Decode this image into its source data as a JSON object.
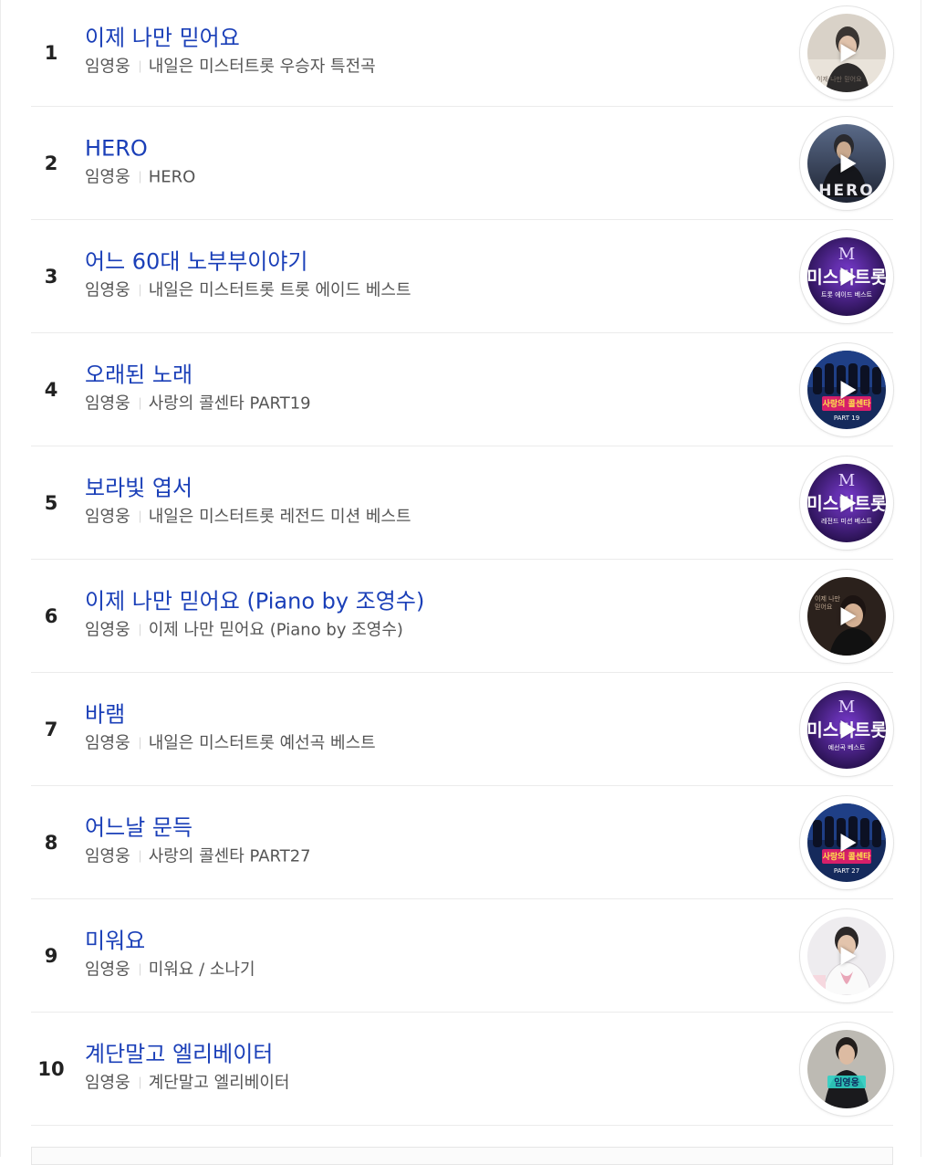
{
  "songs": [
    {
      "rank": "1",
      "title": "이제 나만 믿어요",
      "artist": "임영웅",
      "album": "내일은 미스터트롯 우승자 특전곡",
      "art_icon": "album-art-portrait-light"
    },
    {
      "rank": "2",
      "title": "HERO",
      "artist": "임영웅",
      "album": "HERO",
      "art_icon": "album-art-hero"
    },
    {
      "rank": "3",
      "title": "어느 60대 노부부이야기",
      "artist": "임영웅",
      "album": "내일은 미스터트롯 트롯 에이드 베스트",
      "art_icon": "album-art-mrtrot",
      "art_caption": "트롯 에이드 베스트"
    },
    {
      "rank": "4",
      "title": "오래된 노래",
      "artist": "임영웅",
      "album": "사랑의 콜센타 PART19",
      "art_icon": "album-art-callcenter",
      "art_caption": "PART 19"
    },
    {
      "rank": "5",
      "title": "보라빛 엽서",
      "artist": "임영웅",
      "album": "내일은 미스터트롯 레전드 미션 베스트",
      "art_icon": "album-art-mrtrot",
      "art_caption": "레전드 미션 베스트"
    },
    {
      "rank": "6",
      "title": "이제 나만 믿어요 (Piano by 조영수)",
      "artist": "임영웅",
      "album": "이제 나만 믿어요 (Piano by 조영수)",
      "art_icon": "album-art-portrait-dark"
    },
    {
      "rank": "7",
      "title": "바램",
      "artist": "임영웅",
      "album": "내일은 미스터트롯 예선곡 베스트",
      "art_icon": "album-art-mrtrot",
      "art_caption": "예선곡 베스트"
    },
    {
      "rank": "8",
      "title": "어느날 문득",
      "artist": "임영웅",
      "album": "사랑의 콜센타 PART27",
      "art_icon": "album-art-callcenter",
      "art_caption": "PART 27"
    },
    {
      "rank": "9",
      "title": "미워요",
      "artist": "임영웅",
      "album": "미워요 / 소나기",
      "art_icon": "album-art-portrait-white"
    },
    {
      "rank": "10",
      "title": "계단말고 엘리베이터",
      "artist": "임영웅",
      "album": "계단말고 엘리베이터",
      "art_icon": "album-art-elevator"
    }
  ],
  "colors": {
    "title_link": "#1a3fb8",
    "meta_text": "#555555",
    "rank_text": "#222222",
    "divider": "#ebebeb"
  }
}
